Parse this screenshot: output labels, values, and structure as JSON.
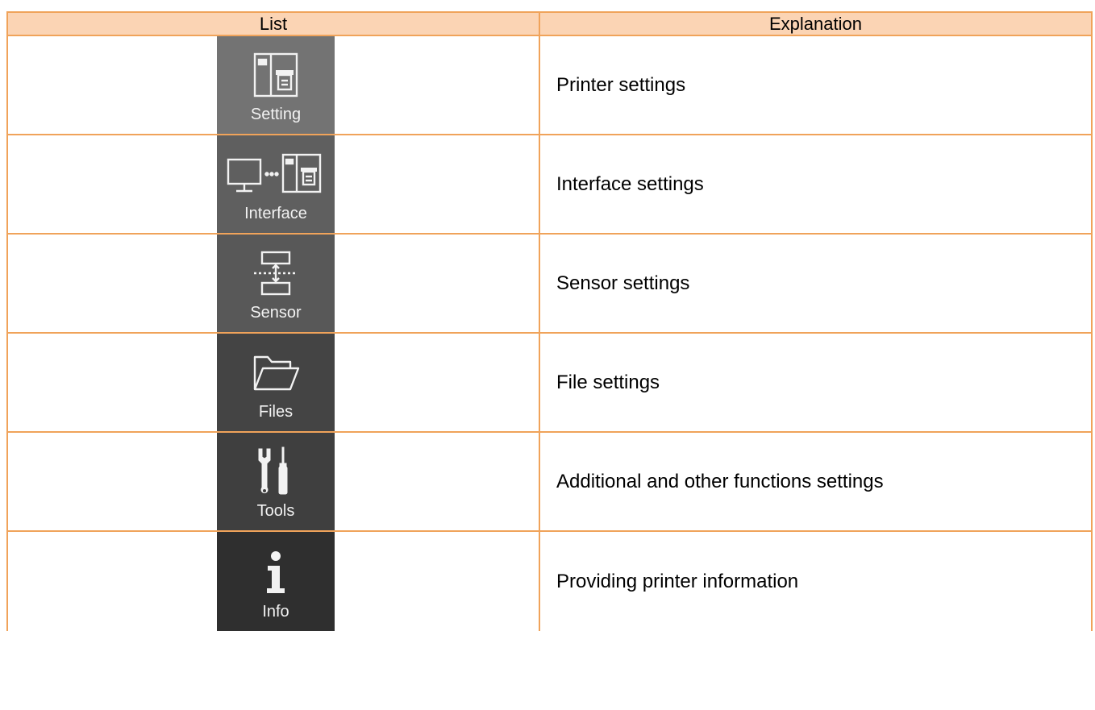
{
  "header": {
    "col_list": "List",
    "col_explanation": "Explanation"
  },
  "rows": [
    {
      "label": "Setting",
      "icon": "printer-icon",
      "explanation": "Printer settings"
    },
    {
      "label": "Interface",
      "icon": "computer-printer-icon",
      "explanation": "Interface settings"
    },
    {
      "label": "Sensor",
      "icon": "sensor-icon",
      "explanation": "Sensor settings"
    },
    {
      "label": "Files",
      "icon": "folder-icon",
      "explanation": "File settings"
    },
    {
      "label": "Tools",
      "icon": "tools-icon",
      "explanation": "Additional and other functions settings"
    },
    {
      "label": "Info",
      "icon": "info-icon",
      "explanation": "Providing printer information"
    }
  ],
  "colors": {
    "border": "#f0a35a",
    "header_bg": "#fbd4b4"
  }
}
